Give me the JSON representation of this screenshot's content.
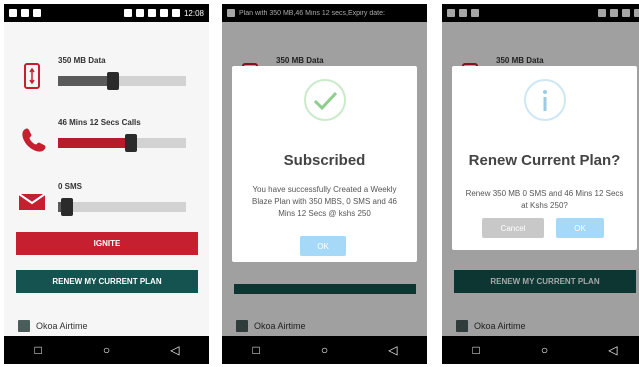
{
  "status": {
    "time": "12:08"
  },
  "notification": {
    "text": "Plan with 350 MB,46 Mins 12 secs,Expiry date:"
  },
  "plans": {
    "data": {
      "label": "350 MB Data",
      "level": 0.42
    },
    "calls": {
      "label": "46 Mins 12 Secs Calls",
      "level": 0.58
    },
    "sms": {
      "label": "0 SMS",
      "level": 0.03
    }
  },
  "buttons": {
    "ignite": "IGNITE",
    "renew": "RENEW MY CURRENT PLAN"
  },
  "okoa": {
    "label": "Okoa Airtime"
  },
  "dialog_subscribed": {
    "title": "Subscribed",
    "message": "You have successfully Created a Weekly Blaze Plan with 350 MBS, 0 SMS and 46 Mins 12 Secs @ kshs 250",
    "ok": "OK"
  },
  "dialog_renew": {
    "title": "Renew Current Plan?",
    "message": "Renew 350 MB 0 SMS and 46 Mins 12 Secs at Kshs 250?",
    "cancel": "Cancel",
    "ok": "OK"
  },
  "colors": {
    "red": "#c62030",
    "teal": "#14534f",
    "ok_blue": "#a6d9f7"
  },
  "icons": [
    "phone-data-icon",
    "phone-call-icon",
    "envelope-icon",
    "checkmark-icon",
    "info-icon"
  ]
}
